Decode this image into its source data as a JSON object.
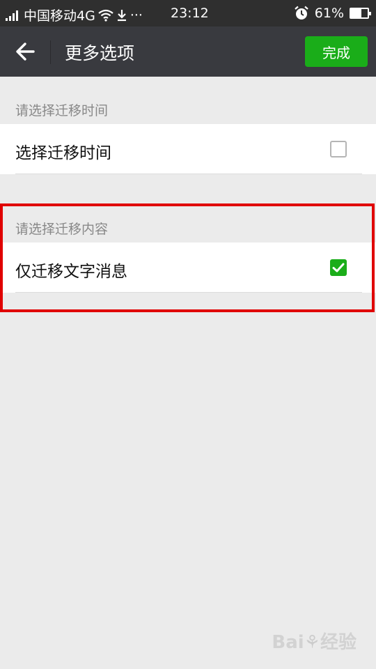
{
  "status_bar": {
    "carrier": "中国移动4G",
    "dots": "···",
    "time": "23:12",
    "battery": "61%",
    "battery_level": 0.61
  },
  "nav": {
    "title": "更多选项",
    "done_label": "完成"
  },
  "sections": [
    {
      "header": "请选择迁移时间",
      "row_label": "选择迁移时间",
      "checked": false
    },
    {
      "header": "请选择迁移内容",
      "row_label": "仅迁移文字消息",
      "checked": true
    }
  ],
  "colors": {
    "accent": "#1aad19",
    "highlight": "#e00000",
    "nav_bg": "#393a3f"
  },
  "watermark": "Baidu经验"
}
